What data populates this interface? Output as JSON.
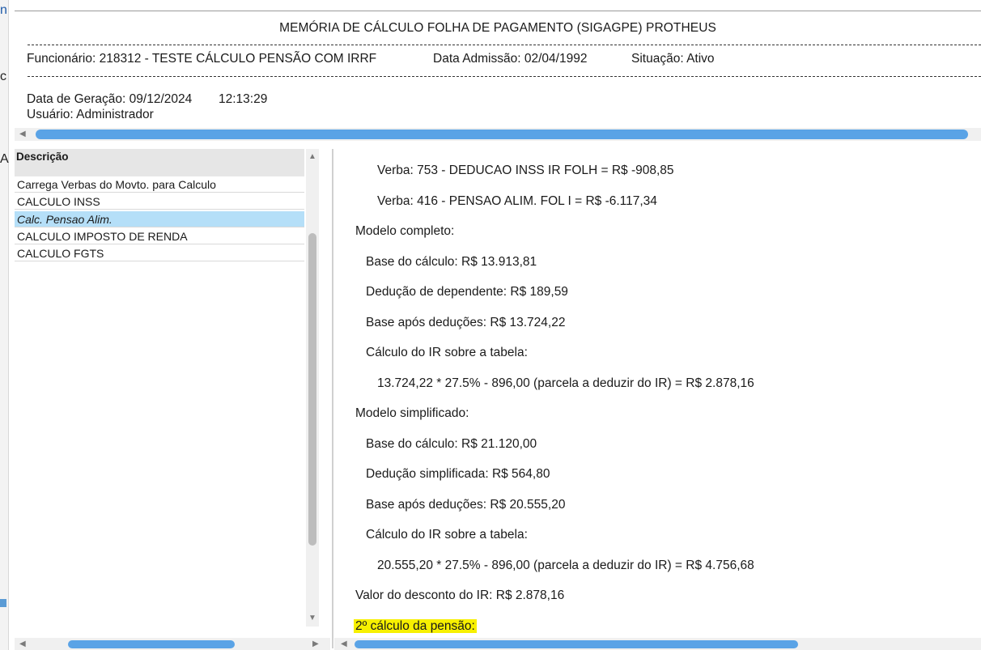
{
  "header": {
    "title": "MEMÓRIA DE CÁLCULO FOLHA DE PAGAMENTO (SIGAGPE) PROTHEUS",
    "employee": "Funcionário: 218312 - TESTE CÁLCULO PENSÃO COM IRRF",
    "admission": "Data Admissão: 02/04/1992",
    "status": "Situação: Ativo",
    "generation_date": "Data de Geração: 09/12/2024",
    "generation_time": "12:13:29",
    "user": "Usuário: Administrador"
  },
  "left_panel": {
    "column_header": "Descrição",
    "items": [
      "Carrega Verbas do Movto. para Calculo",
      "CALCULO INSS",
      "Calc. Pensao Alim.",
      "CALCULO IMPOSTO DE RENDA",
      "CALCULO FGTS"
    ],
    "selected_index": 2
  },
  "detail": {
    "lines": [
      "Verba: 753 - DEDUCAO INSS IR FOLH = R$ -908,85",
      "Verba: 416 - PENSAO ALIM. FOL I = R$ -6.117,34",
      "Modelo completo:",
      "Base do cálculo: R$ 13.913,81",
      "Dedução de dependente: R$ 189,59",
      "Base após deduções: R$ 13.724,22",
      "Cálculo do IR sobre a tabela:",
      "13.724,22 * 27.5% - 896,00 (parcela a deduzir do IR) = R$ 2.878,16",
      "Modelo simplificado:",
      "Base do cálculo: R$ 21.120,00",
      "Dedução simplificada: R$ 564,80",
      "Base após deduções: R$ 20.555,20",
      "Cálculo do IR sobre a tabela:",
      "20.555,20 * 27.5% - 896,00 (parcela a deduzir do IR) = R$ 4.756,68",
      "Valor do desconto do IR: R$ 2.878,16",
      "2º cálculo da pensão:"
    ],
    "highlight_color": "#f7f000"
  },
  "colors": {
    "selection": "#b5dff8",
    "scroll_thumb": "#5aa3e6",
    "header_bg": "#e6e6e6"
  },
  "icons": [
    "scroll-up-arrow",
    "scroll-down-arrow",
    "scroll-left-arrow",
    "scroll-right-arrow"
  ]
}
